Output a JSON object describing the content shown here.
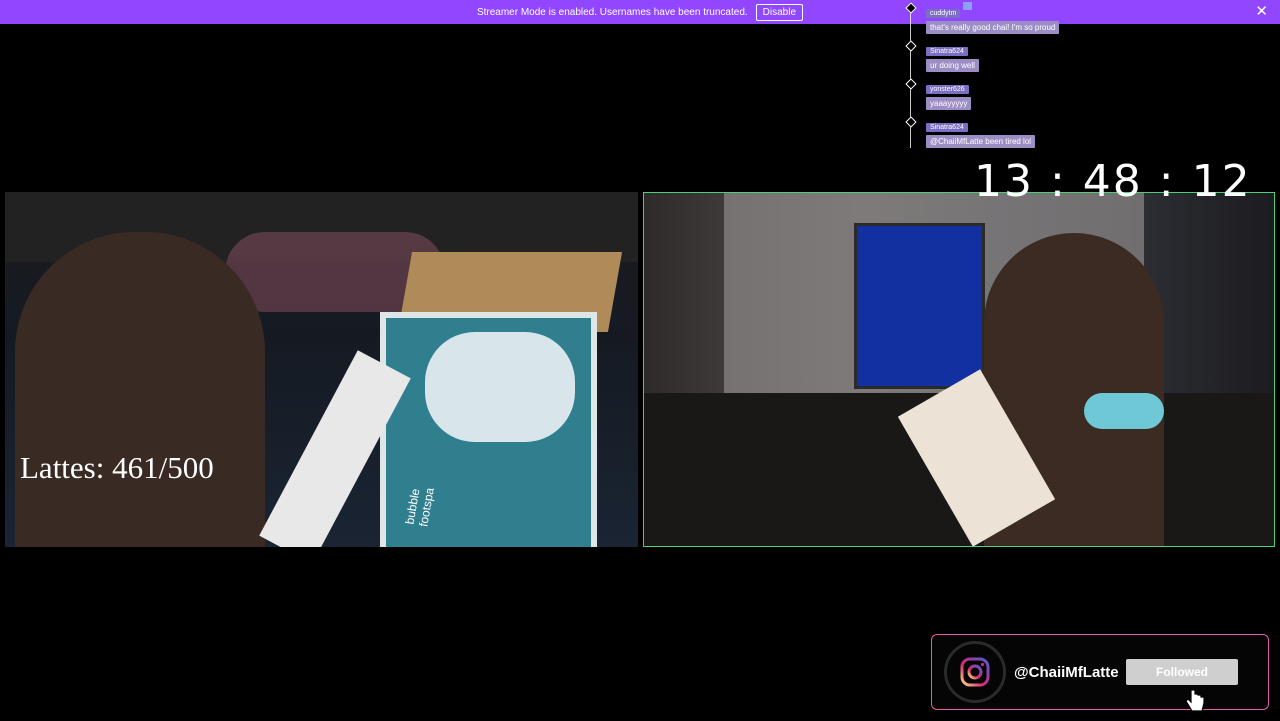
{
  "banner": {
    "message": "Streamer Mode is enabled. Usernames have been truncated.",
    "disable_label": "Disable",
    "close_glyph": "✕",
    "color": "#9147ff"
  },
  "chat": {
    "messages": [
      {
        "user": "cuddytm",
        "text": "that's really good chai! I'm so proud"
      },
      {
        "user": "Sinatra624",
        "text": "ur doing well"
      },
      {
        "user": "yonster626",
        "text": "yaaayyyyy"
      },
      {
        "user": "Sinatra624",
        "text": "@ChaiiMfLatte been tired lol"
      }
    ]
  },
  "timer": "13 : 48 : 12",
  "lattes": "Lattes: 461/500",
  "cams": {
    "left_box": {
      "line1": "bubble",
      "line2": "footspa"
    }
  },
  "instagram": {
    "handle": "@ChaiiMfLatte",
    "follow_label": "Followed",
    "icon": "instagram-icon",
    "accent": "#e05ea5"
  }
}
